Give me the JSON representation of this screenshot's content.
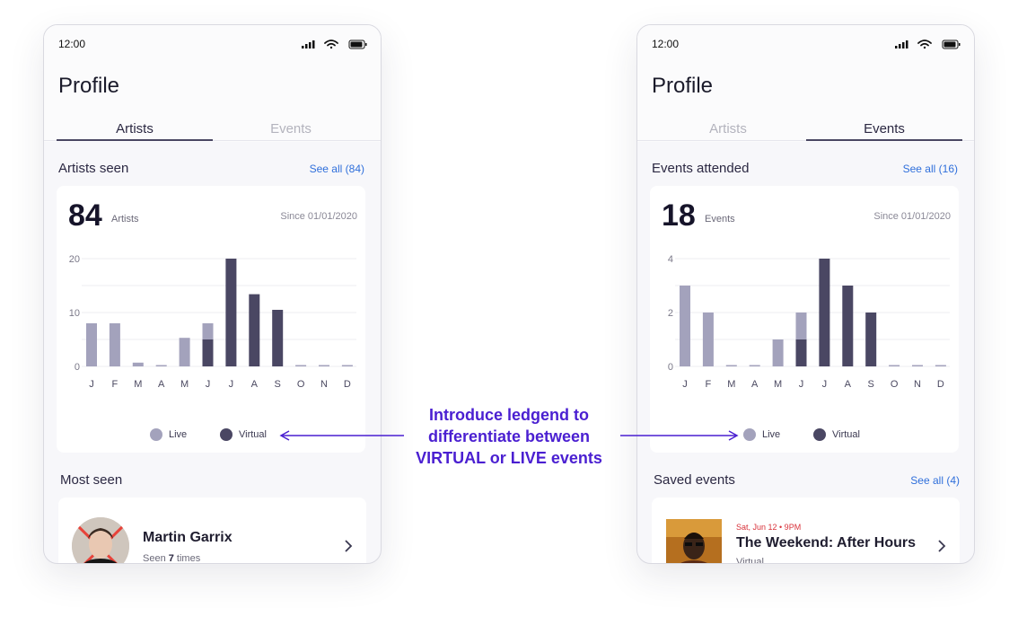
{
  "left": {
    "status_time": "12:00",
    "title": "Profile",
    "tabs": [
      {
        "label": "Artists"
      },
      {
        "label": "Events"
      }
    ],
    "section_title": "Artists seen",
    "see_all": "See all (84)",
    "count": "84",
    "count_unit": "Artists",
    "since": "Since 01/01/2020",
    "legend": [
      {
        "label": "Live"
      },
      {
        "label": "Virtual"
      }
    ],
    "list_title": "Most seen",
    "item": {
      "name": "Martin Garrix",
      "sub_prefix": "Seen ",
      "sub_count": "7",
      "sub_suffix": " times"
    }
  },
  "right": {
    "status_time": "12:00",
    "title": "Profile",
    "tabs": [
      {
        "label": "Artists"
      },
      {
        "label": "Events"
      }
    ],
    "section_title": "Events attended",
    "see_all": "See all (16)",
    "count": "18",
    "count_unit": "Events",
    "since": "Since 01/01/2020",
    "legend": [
      {
        "label": "Live"
      },
      {
        "label": "Virtual"
      }
    ],
    "list_title": "Saved events",
    "list_see_all": "See all (4)",
    "event": {
      "date": "Sat, Jun 12 • 9PM",
      "name": "The Weekend: After Hours",
      "sub": "Virtual"
    }
  },
  "annotation": {
    "line1": "Introduce ledgend to",
    "line2": "differentiate between",
    "line3": "VIRTUAL or LIVE events"
  },
  "colors": {
    "live": "#a3a2bc",
    "virtual": "#4a4763",
    "link": "#2f6fdb",
    "annotation": "#4a1fd1"
  },
  "chart_data": [
    {
      "type": "bar",
      "stacked": true,
      "categories": [
        "J",
        "F",
        "M",
        "A",
        "M",
        "J",
        "J",
        "A",
        "S",
        "O",
        "N",
        "D"
      ],
      "series": [
        {
          "name": "Live",
          "values": [
            8,
            8,
            0.7,
            0.2,
            5.3,
            3,
            0,
            0,
            0,
            0.1,
            0.1,
            0.1
          ]
        },
        {
          "name": "Virtual",
          "values": [
            0,
            0,
            0,
            0,
            0,
            5,
            20,
            13.4,
            10.5,
            0,
            0,
            0
          ]
        }
      ],
      "yticks": [
        0,
        10,
        20
      ],
      "ylim": [
        0,
        20
      ],
      "grid": true,
      "legend": "bottom"
    },
    {
      "type": "bar",
      "stacked": true,
      "categories": [
        "J",
        "F",
        "M",
        "A",
        "M",
        "J",
        "J",
        "A",
        "S",
        "O",
        "N",
        "D"
      ],
      "series": [
        {
          "name": "Live",
          "values": [
            3,
            2,
            0.02,
            0.02,
            1,
            1,
            0,
            0,
            0,
            0.02,
            0.02,
            0.02
          ]
        },
        {
          "name": "Virtual",
          "values": [
            0,
            0,
            0,
            0,
            0,
            1,
            4,
            3,
            2,
            0,
            0,
            0
          ]
        }
      ],
      "yticks": [
        0,
        2,
        4
      ],
      "ylim": [
        0,
        4
      ],
      "grid": true,
      "legend": "bottom"
    }
  ]
}
